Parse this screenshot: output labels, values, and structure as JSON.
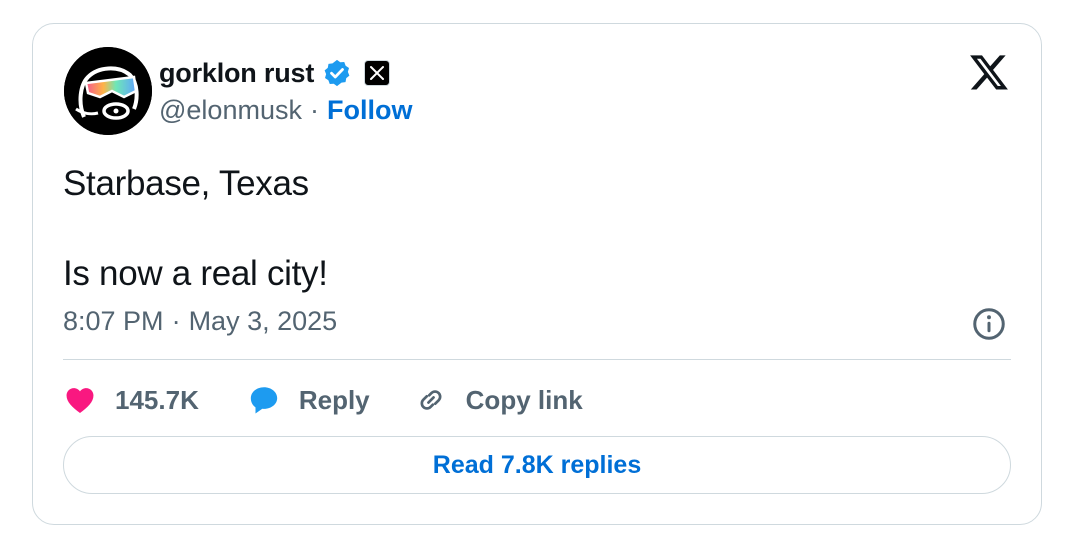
{
  "author": {
    "display_name": "gorklon rust",
    "handle": "@elonmusk",
    "separator": "·",
    "follow_label": "Follow"
  },
  "tweet": {
    "line1": "Starbase, Texas",
    "line2": "Is now a real city!"
  },
  "meta": {
    "time": "8:07 PM",
    "separator": "·",
    "date": "May 3, 2025"
  },
  "actions": {
    "likes": "145.7K",
    "reply_label": "Reply",
    "copy_label": "Copy link"
  },
  "read_replies_label": "Read 7.8K replies",
  "colors": {
    "link_blue": "#006fd6",
    "like_pink": "#f91880",
    "reply_blue": "#1d9bf0",
    "muted_gray": "#536471",
    "border_gray": "#cfd9de"
  },
  "icons": [
    "avatar-image",
    "verified-icon",
    "x-badge-icon",
    "x-logo-icon",
    "info-icon",
    "heart-icon",
    "reply-bubble-icon",
    "link-icon"
  ]
}
